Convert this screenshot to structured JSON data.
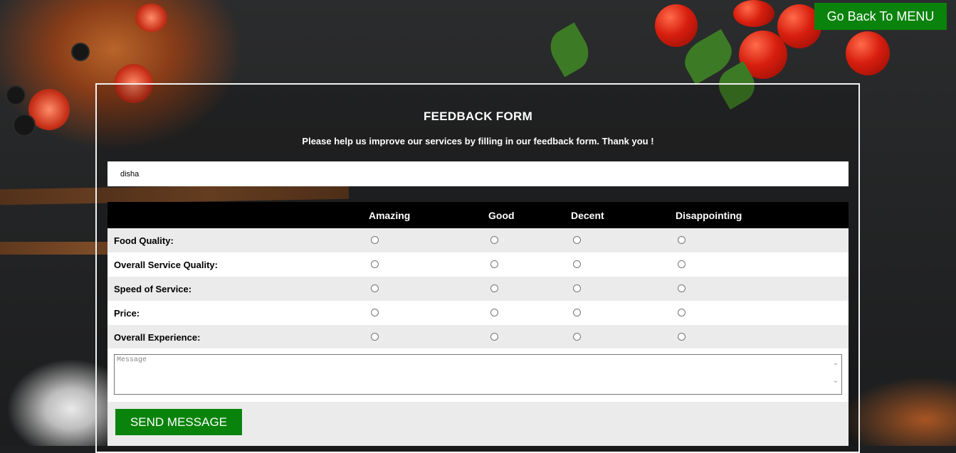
{
  "nav": {
    "go_back_label": "Go Back To MENU"
  },
  "form": {
    "title": "FEEDBACK FORM",
    "subtitle": "Please help us improve our services by filling in our feedback form. Thank you !",
    "name_value": "disha",
    "columns": [
      "Amazing",
      "Good",
      "Decent",
      "Disappointing"
    ],
    "rows": [
      {
        "label": "Food Quality:"
      },
      {
        "label": "Overall Service Quality:"
      },
      {
        "label": "Speed of Service:"
      },
      {
        "label": "Price:"
      },
      {
        "label": "Overall Experience:"
      }
    ],
    "message_placeholder": "Message",
    "send_label": "SEND MESSAGE"
  },
  "colors": {
    "button_green": "#0a830c",
    "header_black": "#000000",
    "row_alt": "#ebebeb"
  }
}
